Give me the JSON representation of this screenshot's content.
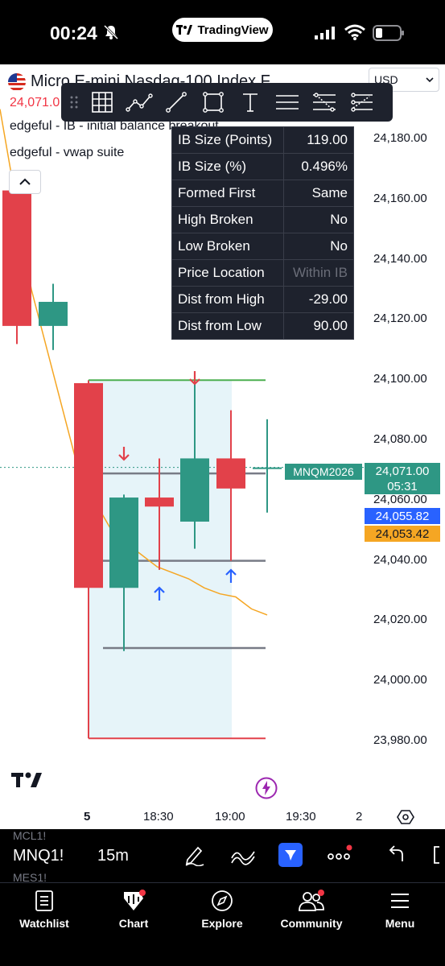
{
  "status_bar": {
    "time": "00:24",
    "app_pill": "TradingView"
  },
  "header": {
    "symbol_title": "Micro E-mini Nasdaq-100 Index F",
    "price": "24,071.0",
    "currency": "USD",
    "indicators": [
      "edgeful - IB - initial balance breakout",
      "edgeful - vwap suite"
    ]
  },
  "ib_table": {
    "rows": [
      {
        "label": "IB Size (Points)",
        "value": "119.00"
      },
      {
        "label": "IB Size (%)",
        "value": "0.496%"
      },
      {
        "label": "Formed First",
        "value": "Same"
      },
      {
        "label": "High Broken",
        "value": "No"
      },
      {
        "label": "Low Broken",
        "value": "No"
      },
      {
        "label": "Price Location",
        "value": "Within IB"
      },
      {
        "label": "Dist from High",
        "value": "-29.00"
      },
      {
        "label": "Dist from Low",
        "value": "90.00"
      }
    ]
  },
  "price_axis": [
    "24,180.00",
    "24,160.00",
    "24,140.00",
    "24,120.00",
    "24,100.00",
    "24,080.00",
    "24,060.00",
    "24,040.00",
    "24,020.00",
    "24,000.00",
    "23,980.00"
  ],
  "price_tags": {
    "symbol": "MNQM2026",
    "last": "24,071.00",
    "countdown": "05:31",
    "blue": "24,055.82",
    "orange": "24,053.42"
  },
  "time_axis": [
    "5",
    "18:30",
    "19:00",
    "19:30",
    "2"
  ],
  "chart_data": {
    "type": "candlestick",
    "candles": [
      {
        "open": 24163,
        "high": 24163,
        "low": 24112,
        "close": 24118
      },
      {
        "open": 24118,
        "high": 24132,
        "low": 24110,
        "close": 24126
      },
      {
        "open": 24099,
        "high": 24099,
        "low": 24031,
        "close": 24031
      },
      {
        "open": 24031,
        "high": 24062,
        "low": 24010,
        "close": 24061
      },
      {
        "open": 24061,
        "high": 24074,
        "low": 24037,
        "close": 24058
      },
      {
        "open": 24053,
        "high": 24100,
        "low": 24044,
        "close": 24074
      },
      {
        "open": 24074,
        "high": 24090,
        "low": 24040,
        "close": 24064
      },
      {
        "open": 24071,
        "high": 24087,
        "low": 24056,
        "close": 24071
      }
    ],
    "levels": {
      "ib_high": 24100,
      "ib_low": 23981,
      "mid_upper": 24069,
      "mid_lower": 24040,
      "lower": 24011
    },
    "vwap": [
      24190,
      24160,
      24130,
      24110,
      24090,
      24070,
      24060,
      24051,
      24046,
      24042,
      24038,
      24036,
      24034,
      24031,
      24029,
      24028,
      24024,
      24022
    ],
    "ylim": [
      23977,
      24194
    ],
    "colors": {
      "up": "#2e9784",
      "down": "#e2414a",
      "vwap": "#f5a623",
      "ib_high": "#4caf50",
      "ib_low": "#e2414a",
      "mid": "#787b86",
      "zone": "#e6f4f9"
    }
  },
  "chart_toolbar": {
    "symbol": "MNQ1!",
    "timeframe": "15m",
    "ghost_above": "MCL1!",
    "ghost_below": "MES1!"
  },
  "tabs": [
    "Watchlist",
    "Chart",
    "Explore",
    "Community",
    "Menu"
  ]
}
